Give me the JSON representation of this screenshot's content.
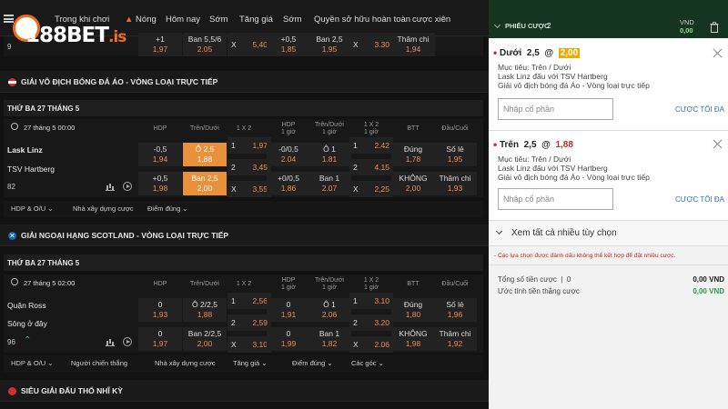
{
  "nav": [
    "Trong khi chơi",
    "Nóng",
    "Hôm nay",
    "Sớm",
    "Tăng giá",
    "Sớm",
    "Quyền sở hữu hoàn toàn",
    "cược xiên"
  ],
  "logo": {
    "main": "188",
    "brand": "BET",
    "suffix": ".is"
  },
  "partial_row": {
    "id": "9",
    "c1": [
      "+1",
      "1,97"
    ],
    "c2": [
      "Ban 5,5/6",
      "2.05"
    ],
    "c3": [
      "X",
      "5,40"
    ],
    "c4": [
      "+0,5",
      "1,85"
    ],
    "c5": [
      "Ban 2,5",
      "1.95"
    ],
    "c6": [
      "X",
      "3.30"
    ],
    "c7": [
      "Thâm chi",
      "1,94"
    ]
  },
  "league1": "GIẢI VÔ ĐỊCH BÓNG ĐÁ ÁO - VÒNG LOẠI TRỰC TIẾP",
  "date1": "THỨ BA 27 THÁNG 5",
  "match1": {
    "time": "27 tháng 5 00:00",
    "heads": [
      "HDP",
      "Trên/Dưới",
      "1 X 2",
      "HDP\n1 giờ",
      "Trên/Dưới\n1 giờ",
      "1 X 2\n1 giờ",
      "BTT",
      "Đầu/Cuối"
    ],
    "home": "Lask Linz",
    "away": "TSV Hartberg",
    "id": "82",
    "r1": [
      [
        "-0,5",
        "1,94"
      ],
      [
        "Ô 2,5",
        "1,88"
      ],
      [
        "1",
        "1,97"
      ],
      [
        "-0/0,5",
        "2.04"
      ],
      [
        "Ô 1",
        "1.81"
      ],
      [
        "1",
        "2.42"
      ],
      [
        "Đúng",
        "1,78"
      ],
      [
        "Số lẻ",
        "1,95"
      ]
    ],
    "r1mid": [
      "2",
      "3,45",
      "2",
      "4.15"
    ],
    "r2": [
      [
        "+0,5",
        "1,98"
      ],
      [
        "Ban 2,5",
        "2,00"
      ],
      [
        "X",
        "3,55"
      ],
      [
        "+0/0,5",
        "1,86"
      ],
      [
        "Ban 1",
        "2.07"
      ],
      [
        "X",
        "2,25"
      ],
      [
        "KHÔNG",
        "2,00"
      ],
      [
        "Thâm chi",
        "1,93"
      ]
    ],
    "pills": [
      "HDP & O/U",
      "Nhà xây dựng cược",
      "Điểm đúng"
    ]
  },
  "league2": "GIẢI NGOẠI HẠNG SCOTLAND - VÒNG LOẠI TRỰC TIẾP",
  "date2": "THỨ BA 27 THÁNG 5",
  "match2": {
    "time": "27 tháng 5 02:00",
    "heads": [
      "HDP",
      "Trên/Dưới",
      "1 X 2",
      "HDP\n1 giờ",
      "Trên/Dưới\n1 giờ",
      "1 X 2\n1 giờ",
      "BTT",
      "Đầu/Cuối"
    ],
    "home": "Quận Ross",
    "away": "Sông ở đây",
    "id": "96",
    "r1": [
      [
        "0",
        "1,93"
      ],
      [
        "Ô 2/2,5",
        "1,88"
      ],
      [
        "1",
        "2,56"
      ],
      [
        "0",
        "1,91"
      ],
      [
        "Ô 1",
        "2.06"
      ],
      [
        "1",
        "3.10"
      ],
      [
        "Đúng",
        "1,80"
      ],
      [
        "Số lẻ",
        "1,96"
      ]
    ],
    "r1mid": [
      "2",
      "2,59",
      "2",
      "3.20"
    ],
    "r2": [
      [
        "0",
        "1,97"
      ],
      [
        "Ban 2/2,5",
        "2,00"
      ],
      [
        "X",
        "3.10"
      ],
      [
        "0",
        "1,99"
      ],
      [
        "Ban 1",
        "1,82"
      ],
      [
        "X",
        "2.06"
      ],
      [
        "KHÔNG",
        "1,98"
      ],
      [
        "Thâm chi",
        "1,92"
      ]
    ],
    "pills": [
      "HDP & O/U",
      "Người chiến thắng",
      "Nhà xây dựng cược",
      "Tăng giá",
      "Điểm đúng",
      "Các góc"
    ]
  },
  "league3": "SIÊU GIẢI ĐẤU THỔ NHĨ KỲ",
  "slip": {
    "title": "PHIẾU CƯỢC",
    "count": "2",
    "currency": "VND",
    "balance": "0,00",
    "bets": [
      {
        "pick": "Dưới",
        "line": "2,5",
        "at": "@",
        "odds": "2,00",
        "market": "Mục tiêu: Trên / Dưới",
        "match": "Lask Linz đấu với TSV Hartberg",
        "league": "Giải vô địch bóng đá Áo - Vòng loại trực tiếp",
        "placeholder": "Nhập cổ phần",
        "max": "CƯỢC TỐI ĐA"
      },
      {
        "pick": "Trên",
        "line": "2,5",
        "at": "@",
        "odds": "1,88",
        "market": "Mục tiêu: Trên / Dưới",
        "match": "Lask Linz đấu với TSV Hartberg",
        "league": "Giải vô địch bóng đá Áo - Vòng loại trực tiếp",
        "placeholder": "Nhập cổ phần",
        "max": "CƯỢC TỐI ĐA"
      }
    ],
    "more": "Xem tất cả nhiều tùy chọn",
    "warning": "- Các lựa chọn được đánh dấu không thể kết hợp để đặt nhiều cược.",
    "total_label": "Tổng số tiền cược",
    "total_count": "0",
    "total_value": "0,00 VND",
    "win_label": "Ước tính tiền thắng cược",
    "win_value": "0,00 VND"
  },
  "colors": {
    "accent": "#f26b1d",
    "selected": "#e8913a",
    "odds": "#f08c55",
    "slip_header": "#163520",
    "link": "#2a74b8"
  }
}
